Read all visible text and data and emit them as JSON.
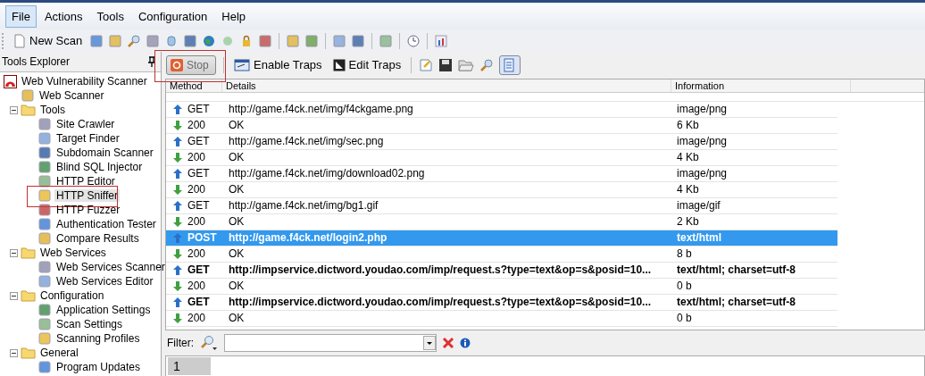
{
  "menu": [
    {
      "label": "File",
      "selected": true
    },
    {
      "label": "Actions",
      "selected": false
    },
    {
      "label": "Tools",
      "selected": false
    },
    {
      "label": "Configuration",
      "selected": false
    },
    {
      "label": "Help",
      "selected": false
    }
  ],
  "toolbar": {
    "new_scan": "New Scan"
  },
  "explorer": {
    "title": "Tools Explorer",
    "tree": [
      {
        "label": "Web Vulnerability Scanner",
        "selected": false,
        "children": [
          {
            "label": "Web Scanner",
            "selected": false
          },
          {
            "label": "Tools",
            "selected": false,
            "expanded": true,
            "children": [
              {
                "label": "Site Crawler",
                "selected": false
              },
              {
                "label": "Target Finder",
                "selected": false
              },
              {
                "label": "Subdomain Scanner",
                "selected": false
              },
              {
                "label": "Blind SQL Injector",
                "selected": false
              },
              {
                "label": "HTTP Editor",
                "selected": false
              },
              {
                "label": "HTTP Sniffer",
                "selected": true
              },
              {
                "label": "HTTP Fuzzer",
                "selected": false
              },
              {
                "label": "Authentication Tester",
                "selected": false
              },
              {
                "label": "Compare Results",
                "selected": false
              }
            ]
          },
          {
            "label": "Web Services",
            "selected": false,
            "expanded": true,
            "children": [
              {
                "label": "Web Services Scanner",
                "selected": false
              },
              {
                "label": "Web Services Editor",
                "selected": false
              }
            ]
          },
          {
            "label": "Configuration",
            "selected": false,
            "expanded": true,
            "children": [
              {
                "label": "Application Settings",
                "selected": false
              },
              {
                "label": "Scan Settings",
                "selected": false
              },
              {
                "label": "Scanning Profiles",
                "selected": false
              }
            ]
          },
          {
            "label": "General",
            "selected": false,
            "expanded": true,
            "children": [
              {
                "label": "Program Updates",
                "selected": false
              }
            ]
          }
        ]
      }
    ]
  },
  "sniffer_toolbar": {
    "stop": {
      "label": "Stop",
      "disabled": true
    },
    "enable_traps": "Enable Traps",
    "edit_traps": "Edit Traps",
    "view_toggle_pressed": true
  },
  "table": {
    "columns": [
      "Method",
      "Details",
      "Information"
    ],
    "rows": [
      {
        "kind": "request",
        "method": "GET",
        "details": "http://game.f4ck.net/img/f4ckgame.png",
        "information": "image/png",
        "bold": false,
        "selected": false
      },
      {
        "kind": "response",
        "method": "200",
        "details": "OK",
        "information": "6 Kb",
        "bold": false,
        "selected": false
      },
      {
        "kind": "request",
        "method": "GET",
        "details": "http://game.f4ck.net/img/sec.png",
        "information": "image/png",
        "bold": false,
        "selected": false
      },
      {
        "kind": "response",
        "method": "200",
        "details": "OK",
        "information": "4 Kb",
        "bold": false,
        "selected": false
      },
      {
        "kind": "request",
        "method": "GET",
        "details": "http://game.f4ck.net/img/download02.png",
        "information": "image/png",
        "bold": false,
        "selected": false
      },
      {
        "kind": "response",
        "method": "200",
        "details": "OK",
        "information": "4 Kb",
        "bold": false,
        "selected": false
      },
      {
        "kind": "request",
        "method": "GET",
        "details": "http://game.f4ck.net/img/bg1.gif",
        "information": "image/gif",
        "bold": false,
        "selected": false
      },
      {
        "kind": "response",
        "method": "200",
        "details": "OK",
        "information": "2 Kb",
        "bold": false,
        "selected": false
      },
      {
        "kind": "request",
        "method": "POST",
        "details": "http://game.f4ck.net/login2.php",
        "information": "text/html",
        "bold": true,
        "selected": true
      },
      {
        "kind": "response",
        "method": "200",
        "details": "OK",
        "information": "8 b",
        "bold": false,
        "selected": false
      },
      {
        "kind": "request",
        "method": "GET",
        "details": "http://impservice.dictword.youdao.com/imp/request.s?type=text&op=s&posid=10...",
        "information": "text/html; charset=utf-8",
        "bold": true,
        "selected": false
      },
      {
        "kind": "response",
        "method": "200",
        "details": "OK",
        "information": "0 b",
        "bold": false,
        "selected": false
      },
      {
        "kind": "request",
        "method": "GET",
        "details": "http://impservice.dictword.youdao.com/imp/request.s?type=text&op=s&posid=10...",
        "information": "text/html; charset=utf-8",
        "bold": true,
        "selected": false
      },
      {
        "kind": "response",
        "method": "200",
        "details": "OK",
        "information": "0 b",
        "bold": false,
        "selected": false
      }
    ]
  },
  "filter": {
    "label": "Filter:"
  },
  "tabs": [
    {
      "label": "1",
      "selected": true
    }
  ]
}
